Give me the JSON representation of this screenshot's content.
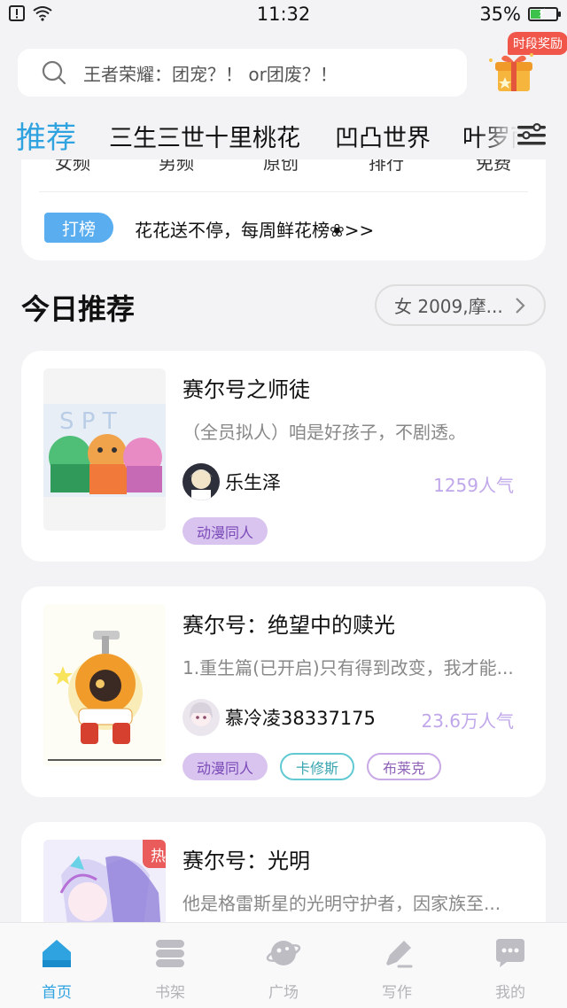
{
  "status_bar": {
    "time": "11:32",
    "battery": "35%",
    "battery_level": 0.35
  },
  "search": {
    "placeholder": "王者荣耀：团宠？！ or团废？！"
  },
  "reward": {
    "label": "时段奖励"
  },
  "tabs": [
    {
      "label": "推荐",
      "active": true
    },
    {
      "label": "三生三世十里桃花"
    },
    {
      "label": "凹凸世界"
    },
    {
      "label": "叶罗丽"
    }
  ],
  "top_card": {
    "categories": [
      "女频",
      "男频",
      "原创",
      "排行",
      "免费"
    ],
    "badge": "打榜",
    "promo": "花花送不停，每周鲜花榜❀>>"
  },
  "section": {
    "title": "今日推荐",
    "filter": "女 2009,摩..."
  },
  "books": [
    {
      "title": "赛尔号之师徒",
      "desc": "（全员拟人）咱是好孩子，不剧透。",
      "author": "乐生泽",
      "popularity": "1259人气",
      "tags": [
        "动漫同人"
      ]
    },
    {
      "title": "赛尔号：绝望中的赎光",
      "desc": "1.重生篇(已开启)只有得到改变，我才能...",
      "author": "慕冷凌38337175",
      "popularity": "23.6万人气",
      "tags": [
        "动漫同人",
        "卡修斯",
        "布莱克"
      ]
    },
    {
      "title": "赛尔号：光明",
      "desc": "他是格雷斯星的光明守护者，因家族至...",
      "badge": "热更"
    }
  ],
  "bottom_nav": [
    {
      "label": "首页",
      "icon": "home-icon",
      "active": true
    },
    {
      "label": "书架",
      "icon": "bookshelf-icon"
    },
    {
      "label": "广场",
      "icon": "planet-icon"
    },
    {
      "label": "写作",
      "icon": "pen-icon"
    },
    {
      "label": "我的",
      "icon": "chat-bubble-icon"
    }
  ],
  "colors": {
    "accent": "#2fa2e0",
    "popularity": "#c0a7ea",
    "hot": "#ea5b5b"
  }
}
